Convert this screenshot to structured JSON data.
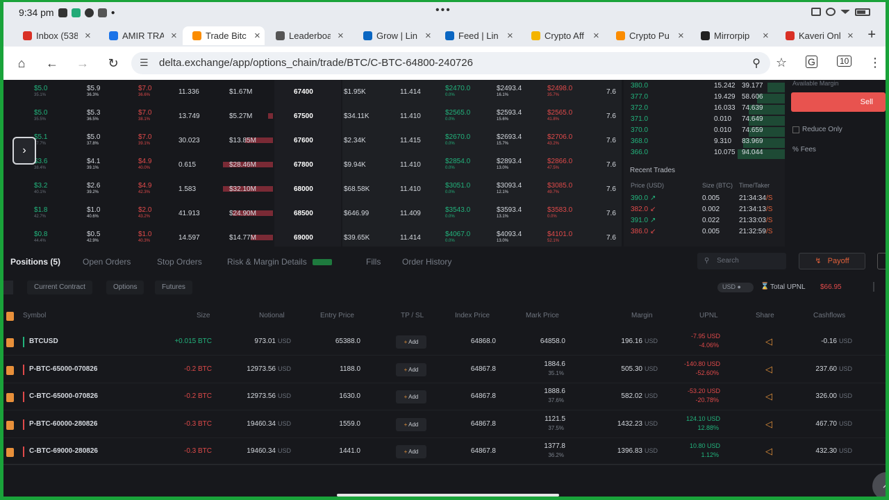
{
  "status_bar": {
    "time": "9:34 pm",
    "dots": "•••"
  },
  "tabs": [
    {
      "label": "Inbox (538",
      "color": "#d93025"
    },
    {
      "label": "AMIR TRA",
      "color": "#1a73e8"
    },
    {
      "label": "Trade Bitc",
      "color": "#fb8c00",
      "active": true
    },
    {
      "label": "Leaderboa",
      "color": "#555555"
    },
    {
      "label": "Grow | Lin",
      "color": "#0a66c2"
    },
    {
      "label": "Feed | Lin",
      "color": "#0a66c2"
    },
    {
      "label": "Crypto Aff",
      "color": "#f4b400"
    },
    {
      "label": "Crypto Pu",
      "color": "#fb8c00"
    },
    {
      "label": "Mirrorpip",
      "color": "#222222"
    },
    {
      "label": "Kaveri Onl",
      "color": "#d93025"
    }
  ],
  "address_bar": {
    "url": "delta.exchange/app/options_chain/trade/BTC/C-BTC-64800-240726"
  },
  "options_chain": {
    "rows": [
      {
        "bid": "$5.0",
        "bid_sub": "35.1%",
        "mark": "$5.9",
        "mark_sub": "36.3%",
        "ask": "$7.0",
        "ask_sub": "36.6%",
        "oi": "11.336",
        "vol": "$1.67M",
        "vol_bar": 0,
        "strike": "67400",
        "vol2": "$1.95K",
        "iv": "11.414",
        "bid2": "$2470.0",
        "bid2_sub": "0.0%",
        "mark2": "$2493.4",
        "mark2_sub": "16.1%",
        "ask2": "$2498.0",
        "ask2_sub": "35.7%",
        "delta": "7.6"
      },
      {
        "bid": "$5.0",
        "bid_sub": "35.5%",
        "mark": "$5.3",
        "mark_sub": "36.5%",
        "ask": "$7.0",
        "ask_sub": "38.1%",
        "oi": "13.749",
        "vol": "$5.27M",
        "vol_bar": 0.1,
        "strike": "67500",
        "vol2": "$34.11K",
        "iv": "11.410",
        "bid2": "$2565.0",
        "bid2_sub": "0.0%",
        "mark2": "$2593.4",
        "mark2_sub": "15.6%",
        "ask2": "$2565.0",
        "ask2_sub": "41.8%",
        "delta": "7.6"
      },
      {
        "bid": "$5.1",
        "bid_sub": "37.7%",
        "mark": "$5.0",
        "mark_sub": "37.8%",
        "ask": "$7.0",
        "ask_sub": "39.1%",
        "oi": "30.023",
        "vol": "$13.85M",
        "vol_bar": 0.55,
        "strike": "67600",
        "vol2": "$2.34K",
        "iv": "11.415",
        "bid2": "$2670.0",
        "bid2_sub": "0.0%",
        "mark2": "$2693.4",
        "mark2_sub": "15.7%",
        "ask2": "$2706.0",
        "ask2_sub": "43.2%",
        "delta": "7.6"
      },
      {
        "bid": "$3.6",
        "bid_sub": "38.4%",
        "mark": "$4.1",
        "mark_sub": "39.1%",
        "ask": "$4.9",
        "ask_sub": "40.0%",
        "oi": "0.615",
        "vol": "$28.46M",
        "vol_bar": 1,
        "strike": "67800",
        "vol2": "$9.94K",
        "iv": "11.410",
        "bid2": "$2854.0",
        "bid2_sub": "0.0%",
        "mark2": "$2893.4",
        "mark2_sub": "13.0%",
        "ask2": "$2866.0",
        "ask2_sub": "47.5%",
        "delta": "7.6"
      },
      {
        "bid": "$3.2",
        "bid_sub": "40.1%",
        "mark": "$2.6",
        "mark_sub": "39.2%",
        "ask": "$4.9",
        "ask_sub": "42.3%",
        "oi": "1.583",
        "vol": "$32.10M",
        "vol_bar": 1,
        "strike": "68000",
        "vol2": "$68.58K",
        "iv": "11.410",
        "bid2": "$3051.0",
        "bid2_sub": "0.0%",
        "mark2": "$3093.4",
        "mark2_sub": "12.1%",
        "ask2": "$3085.0",
        "ask2_sub": "49.7%",
        "delta": "7.6"
      },
      {
        "bid": "$1.8",
        "bid_sub": "42.7%",
        "mark": "$1.0",
        "mark_sub": "40.6%",
        "ask": "$2.0",
        "ask_sub": "43.2%",
        "oi": "41.913",
        "vol": "$24.90M",
        "vol_bar": 0.8,
        "strike": "68500",
        "vol2": "$646.99",
        "iv": "11.409",
        "bid2": "$3543.0",
        "bid2_sub": "0.0%",
        "mark2": "$3593.4",
        "mark2_sub": "13.1%",
        "ask2": "$3583.0",
        "ask2_sub": "0.0%",
        "delta": "7.6"
      },
      {
        "bid": "$0.8",
        "bid_sub": "44.4%",
        "mark": "$0.5",
        "mark_sub": "42.9%",
        "ask": "$1.0",
        "ask_sub": "40.3%",
        "oi": "14.597",
        "vol": "$14.77M",
        "vol_bar": 0.45,
        "strike": "69000",
        "vol2": "$39.65K",
        "iv": "11.414",
        "bid2": "$4067.0",
        "bid2_sub": "0.0%",
        "mark2": "$4093.4",
        "mark2_sub": "13.0%",
        "ask2": "$4101.0",
        "ask2_sub": "52.1%",
        "delta": "7.6"
      }
    ]
  },
  "order_book": {
    "rows": [
      {
        "price": "380.0",
        "size": "15.242",
        "total": "39.177",
        "depth": 0.25
      },
      {
        "price": "377.0",
        "size": "19.429",
        "total": "58.606",
        "depth": 0.4
      },
      {
        "price": "372.0",
        "size": "16.033",
        "total": "74.639",
        "depth": 0.52
      },
      {
        "price": "371.0",
        "size": "0.010",
        "total": "74.649",
        "depth": 0.52
      },
      {
        "price": "370.0",
        "size": "0.010",
        "total": "74.659",
        "depth": 0.52
      },
      {
        "price": "368.0",
        "size": "9.310",
        "total": "83.969",
        "depth": 0.6
      },
      {
        "price": "366.0",
        "size": "10.075",
        "total": "94.044",
        "depth": 0.68
      }
    ]
  },
  "recent_trades": {
    "title": "Recent Trades",
    "headers": {
      "price": "Price (USD)",
      "size": "Size (BTC)",
      "time": "Time/Taker"
    },
    "rows": [
      {
        "price": "390.0",
        "arrow": "↗",
        "side": "buy",
        "size": "0.005",
        "time": "21:34:34",
        "taker": "/S"
      },
      {
        "price": "382.0",
        "arrow": "↙",
        "side": "sell",
        "size": "0.002",
        "time": "21:34:13",
        "taker": "/S"
      },
      {
        "price": "391.0",
        "arrow": "↗",
        "side": "buy",
        "size": "0.022",
        "time": "21:33:03",
        "taker": "/S"
      },
      {
        "price": "386.0",
        "arrow": "↙",
        "side": "sell",
        "size": "0.005",
        "time": "21:32:59",
        "taker": "/S"
      }
    ]
  },
  "order_panel": {
    "available_margin": "Available Margin",
    "sell_label": "Sell",
    "reduce_only": "Reduce Only",
    "fees": "Fees"
  },
  "positions_tabs": [
    {
      "label": "Positions (5)",
      "active": true
    },
    {
      "label": "Open Orders"
    },
    {
      "label": "Stop Orders"
    },
    {
      "label": "Risk & Margin Details"
    },
    {
      "label": "Fills"
    },
    {
      "label": "Order History"
    }
  ],
  "search_placeholder": "Search",
  "payoff_label": "Payoff",
  "filters": [
    "Current Contract",
    "Options",
    "Futures"
  ],
  "upnl_summary": {
    "currency": "USD",
    "label": "Total UPNL",
    "value": "$66.95"
  },
  "columns": [
    "Symbol",
    "Size",
    "Notional",
    "Entry Price",
    "TP / SL",
    "Index Price",
    "Mark Price",
    "Margin",
    "UPNL",
    "Share",
    "Cashflows"
  ],
  "unit_usd": "USD",
  "add_label": "Add",
  "positions": [
    {
      "symbol": "BTCUSD",
      "side": "long",
      "size": "+0.015 BTC",
      "notional": "973.01",
      "entry": "65388.0",
      "index": "64868.0",
      "mark": "64858.0",
      "mark_sub": "",
      "margin": "196.16",
      "upnl": "-7.95 USD",
      "upnl_sub": "-4.06%",
      "upnl_pos": false,
      "cashflow": "-0.16"
    },
    {
      "symbol": "P-BTC-65000-070826",
      "side": "short",
      "size": "-0.2 BTC",
      "notional": "12973.56",
      "entry": "1188.0",
      "index": "64867.8",
      "mark": "1884.6",
      "mark_sub": "35.1%",
      "margin": "505.30",
      "upnl": "-140.80 USD",
      "upnl_sub": "-52.60%",
      "upnl_pos": false,
      "cashflow": "237.60"
    },
    {
      "symbol": "C-BTC-65000-070826",
      "side": "short",
      "size": "-0.2 BTC",
      "notional": "12973.56",
      "entry": "1630.0",
      "index": "64867.8",
      "mark": "1888.6",
      "mark_sub": "37.6%",
      "margin": "582.02",
      "upnl": "-53.20 USD",
      "upnl_sub": "-20.78%",
      "upnl_pos": false,
      "cashflow": "326.00"
    },
    {
      "symbol": "P-BTC-60000-280826",
      "side": "short",
      "size": "-0.3 BTC",
      "notional": "19460.34",
      "entry": "1559.0",
      "index": "64867.8",
      "mark": "1121.5",
      "mark_sub": "37.5%",
      "margin": "1432.23",
      "upnl": "124.10 USD",
      "upnl_sub": "12.88%",
      "upnl_pos": true,
      "cashflow": "467.70"
    },
    {
      "symbol": "C-BTC-69000-280826",
      "side": "short",
      "size": "-0.3 BTC",
      "notional": "19460.34",
      "entry": "1441.0",
      "index": "64867.8",
      "mark": "1377.8",
      "mark_sub": "36.2%",
      "margin": "1396.83",
      "upnl": "10.80 USD",
      "upnl_sub": "1.12%",
      "upnl_pos": true,
      "cashflow": "432.30"
    }
  ],
  "colors": {
    "buy": "#22b37c",
    "sell": "#e04a4a",
    "accent": "#e0903a",
    "frame": "#1aa33a"
  }
}
